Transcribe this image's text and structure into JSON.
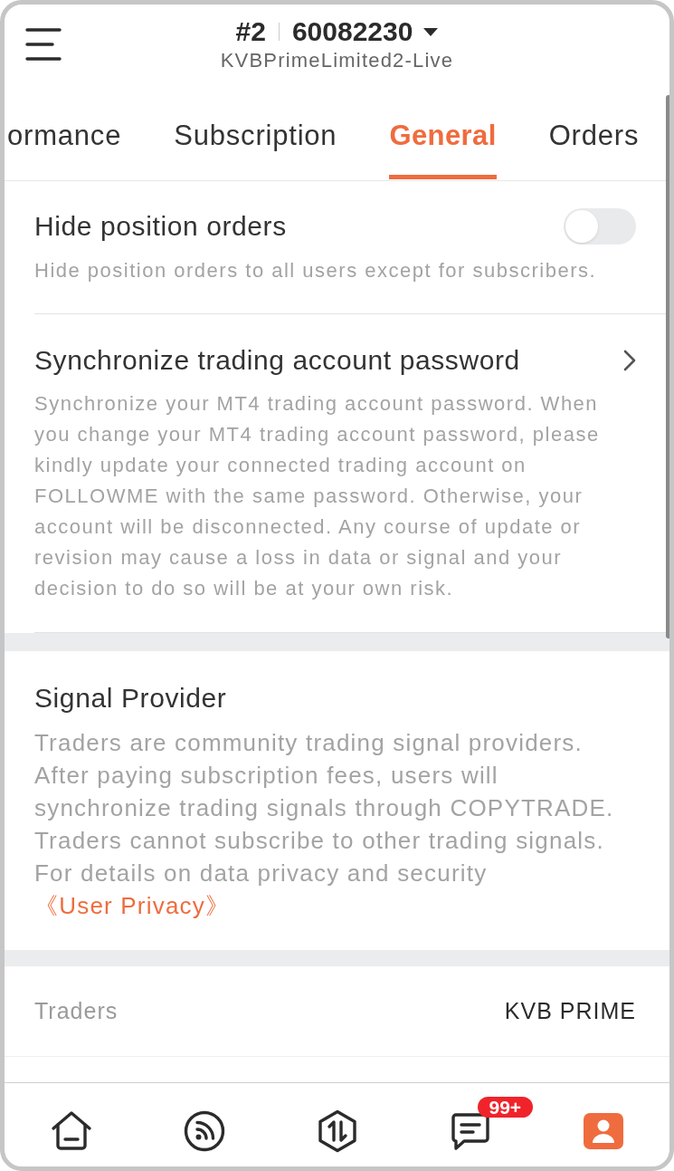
{
  "header": {
    "account_number": "#2",
    "account_id": "60082230",
    "server": "KVBPrimeLimited2-Live"
  },
  "tabs": [
    {
      "label": "ormance",
      "selected": false
    },
    {
      "label": "Subscription",
      "selected": false
    },
    {
      "label": "General",
      "selected": true
    },
    {
      "label": "Orders",
      "selected": false
    }
  ],
  "settings": [
    {
      "kind": "toggle",
      "title": "Hide position orders",
      "description": "Hide position orders to all users except for subscribers.",
      "on": false
    },
    {
      "kind": "link",
      "title": "Synchronize trading account password",
      "description": "Synchronize your MT4 trading account password. When you change your MT4 trading account password, please kindly update your connected trading account on FOLLOWME with the same password. Otherwise, your account will be disconnected. Any course of update or revision may cause a loss in data or signal and your decision to do so will be at your own risk."
    }
  ],
  "signal_provider": {
    "title": "Signal Provider",
    "description": "Traders are community trading signal providers. After paying subscription fees, users will synchronize trading signals through COPYTRADE. Traders cannot subscribe to other trading signals. For details on data privacy and security",
    "link": "《User Privacy》"
  },
  "info_rows": [
    {
      "label": "Traders",
      "value": "KVB PRIME"
    }
  ],
  "bottom_nav": [
    {
      "kind": "home",
      "selected": false
    },
    {
      "kind": "feed",
      "selected": false
    },
    {
      "kind": "trade",
      "selected": false
    },
    {
      "kind": "messages",
      "selected": false,
      "badge": "99+"
    },
    {
      "kind": "profile",
      "selected": true
    }
  ]
}
